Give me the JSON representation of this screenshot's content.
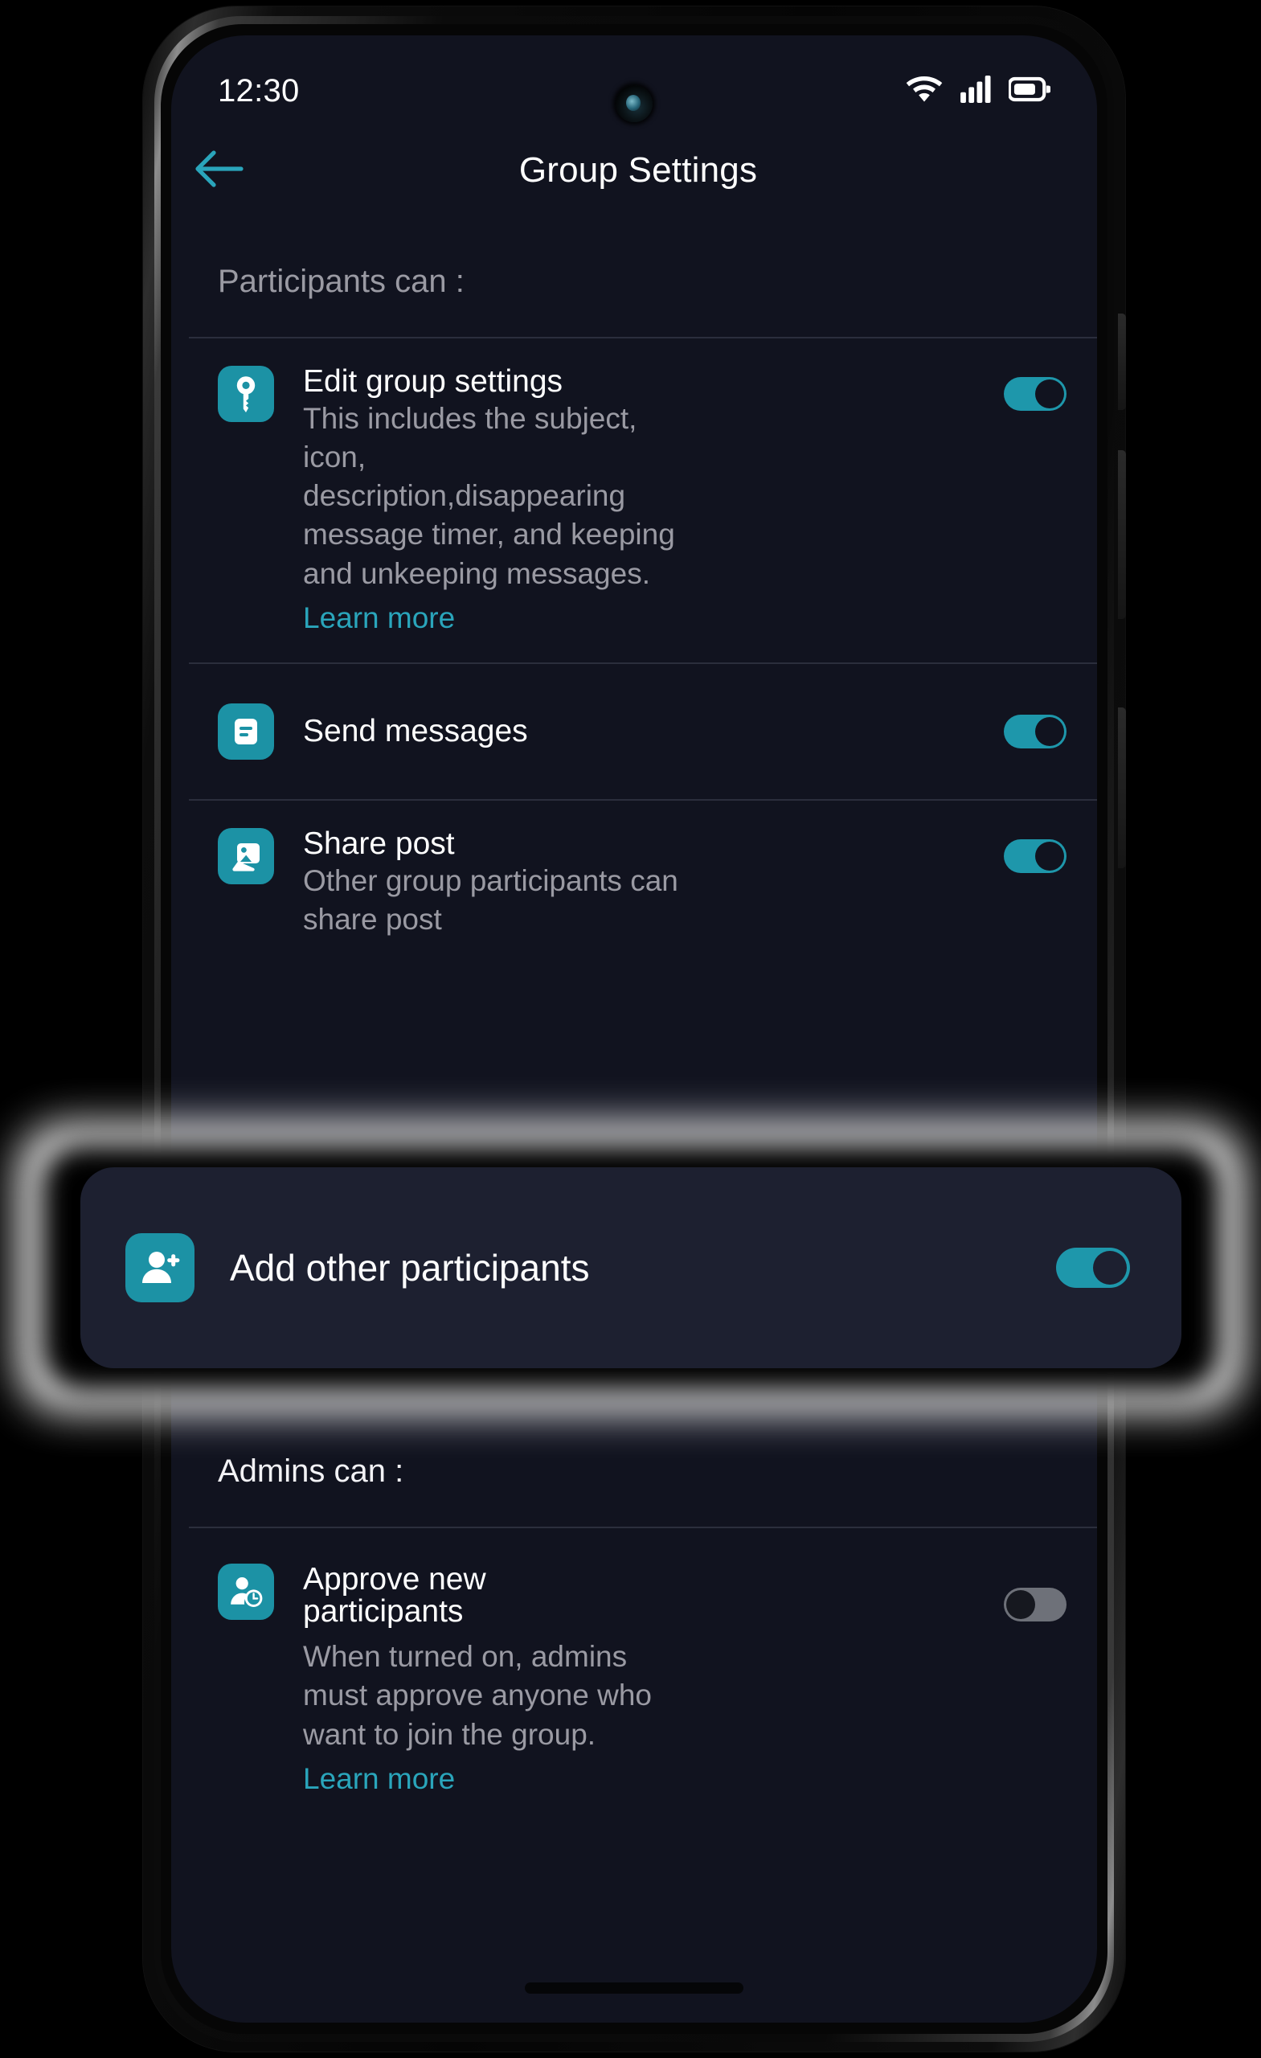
{
  "status_bar": {
    "time": "12:30",
    "icons": [
      "wifi-icon",
      "cellular-signal-icon",
      "battery-icon"
    ]
  },
  "app_bar": {
    "back_icon": "arrow-left-icon",
    "title": "Group Settings"
  },
  "sections": [
    {
      "header": "Participants can :",
      "rows": [
        {
          "icon": "key-icon",
          "title": "Edit group settings",
          "description": "This includes the subject, icon, description,disappearing message timer, and keeping and unkeeping messages.",
          "link": "Learn more",
          "toggle": "on"
        },
        {
          "icon": "message-icon",
          "title": "Send messages",
          "description": "",
          "link": "",
          "toggle": "on"
        },
        {
          "icon": "image-icon",
          "title": "Share post",
          "description": "Other group participants can share post",
          "link": "",
          "toggle": "on"
        }
      ]
    },
    {
      "header": "Admins can :",
      "rows": [
        {
          "icon": "person-clock-icon",
          "title": "Approve new participants",
          "description": "When turned on, admins must approve anyone who want to join the group.",
          "link": "Learn more",
          "toggle": "off"
        }
      ]
    }
  ],
  "highlight": {
    "icon": "person-add-icon",
    "label": "Add other participants",
    "toggle": "on"
  },
  "colors": {
    "accent": "#1c92a5",
    "link": "#2aa5bb",
    "screen_bg": "#11131f",
    "card_bg": "#1d2030",
    "toggle_on": "#1e97ab",
    "toggle_off": "#6e7179",
    "secondary_text": "#9a9aa3"
  }
}
